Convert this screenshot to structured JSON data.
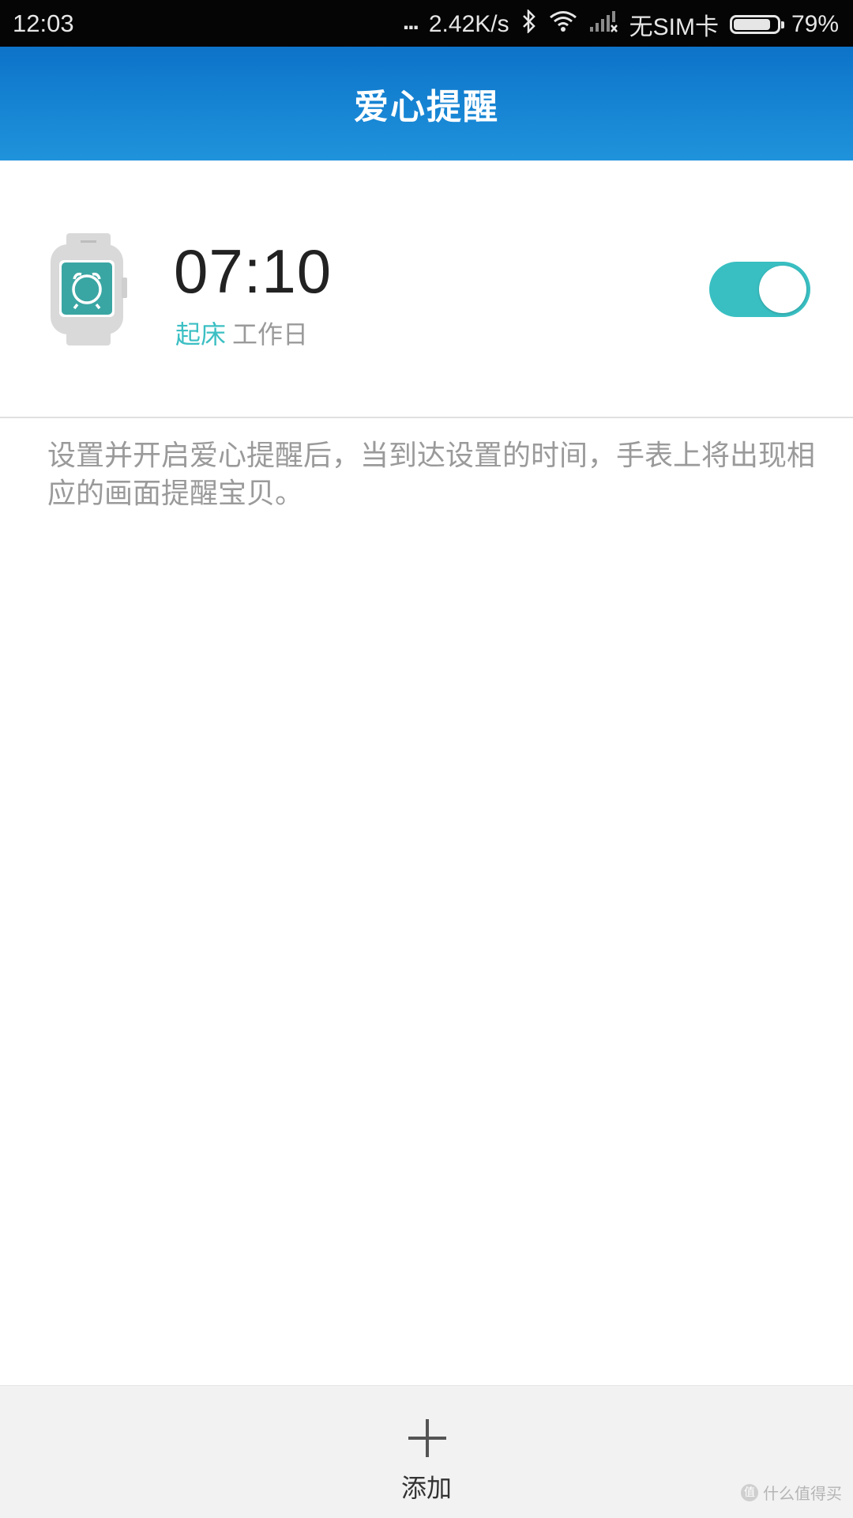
{
  "status_bar": {
    "time": "12:03",
    "dots": "...",
    "net_speed": "2.42K/s",
    "sim": "无SIM卡",
    "battery_percent": "79%",
    "battery_level": 0.79,
    "icons": [
      "bluetooth-icon",
      "wifi-icon",
      "signal-icon"
    ]
  },
  "header": {
    "title": "爱心提醒"
  },
  "reminder": {
    "time": "07:10",
    "label": "起床",
    "repeat": "工作日",
    "enabled": true,
    "icon": "watch-alarm-icon"
  },
  "description": "设置并开启爱心提醒后，当到达设置的时间，手表上将出现相应的画面提醒宝贝。",
  "bottom": {
    "add_label": "添加"
  },
  "watermark": {
    "text": "什么值得买"
  },
  "colors": {
    "header_top": "#0d73c9",
    "header_bottom": "#1f93db",
    "accent": "#39bfc2",
    "muted_text": "#9a9a9a"
  }
}
